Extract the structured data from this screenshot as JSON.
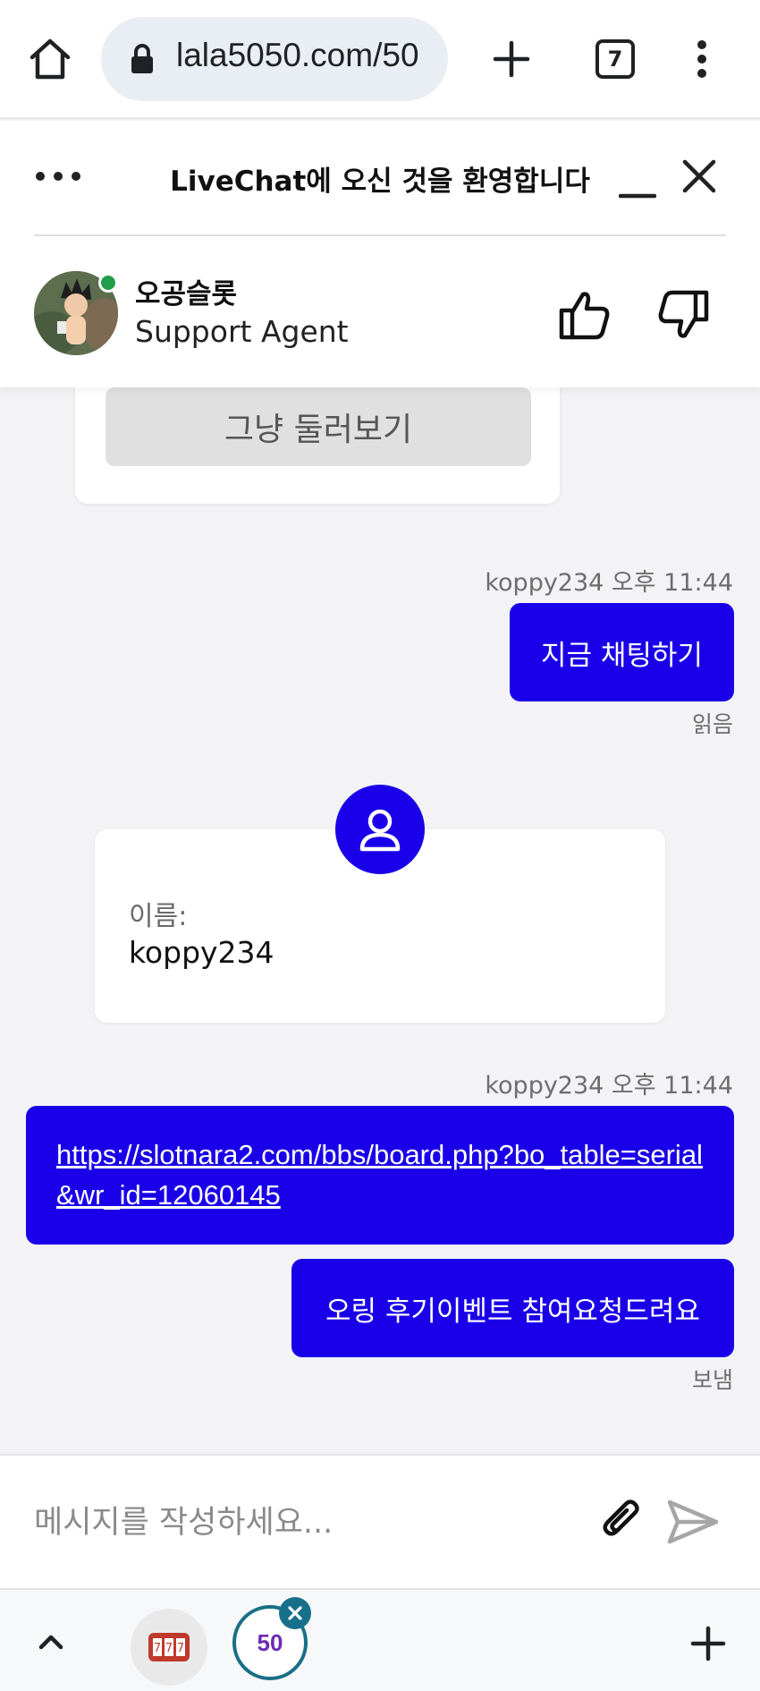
{
  "browser": {
    "url": "lala5050.com/50",
    "tab_count": "7"
  },
  "chat_header": {
    "title": "LiveChat에 오신 것을 환영합니다",
    "agent_name": "오공슬롯",
    "agent_role": "Support Agent"
  },
  "messages": {
    "browse_button": "그냥 둘러보기",
    "msg1_meta": "koppy234 오후 11:44",
    "msg1_text": "지금 채팅하기",
    "msg1_status": "읽음",
    "form_label": "이름:",
    "form_value": "koppy234",
    "msg2_meta": "koppy234 오후 11:44",
    "msg2_link": "https://slotnara2.com/bbs/board.php?bo_table=serial&wr_id=12060145",
    "msg3_text": "오링 후기이벤트 참여요청드려요",
    "msg3_status": "보냄"
  },
  "input": {
    "placeholder": "메시지를 작성하세요..."
  },
  "bottom_bar": {
    "lala_tab_label": "50"
  },
  "colors": {
    "accent": "#1a00e8",
    "online": "#1e9e4a"
  }
}
